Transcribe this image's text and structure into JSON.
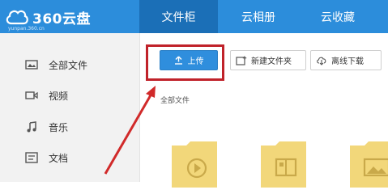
{
  "app": {
    "logo_text": "360云盘",
    "logo_subtext": "yunpan.360.cn"
  },
  "nav": {
    "tabs": [
      {
        "label": "文件柜",
        "active": true
      },
      {
        "label": "云相册"
      },
      {
        "label": "云收藏"
      }
    ]
  },
  "sidebar": {
    "items": [
      {
        "label": "全部文件",
        "icon": "all-files-icon"
      },
      {
        "label": "视频",
        "icon": "video-icon"
      },
      {
        "label": "音乐",
        "icon": "music-icon"
      },
      {
        "label": "文档",
        "icon": "document-icon"
      }
    ]
  },
  "toolbar": {
    "upload_label": "上传",
    "new_folder_label": "新建文件夹",
    "offline_download_label": "离线下载"
  },
  "breadcrumb": "全部文件",
  "folders": [
    {
      "type": "video"
    },
    {
      "type": "document"
    },
    {
      "type": "image"
    }
  ],
  "colors": {
    "header": "#2c8ddb",
    "active_tab": "#1b6fb7",
    "highlight": "#c0222a",
    "folder": "#f2d77a"
  }
}
